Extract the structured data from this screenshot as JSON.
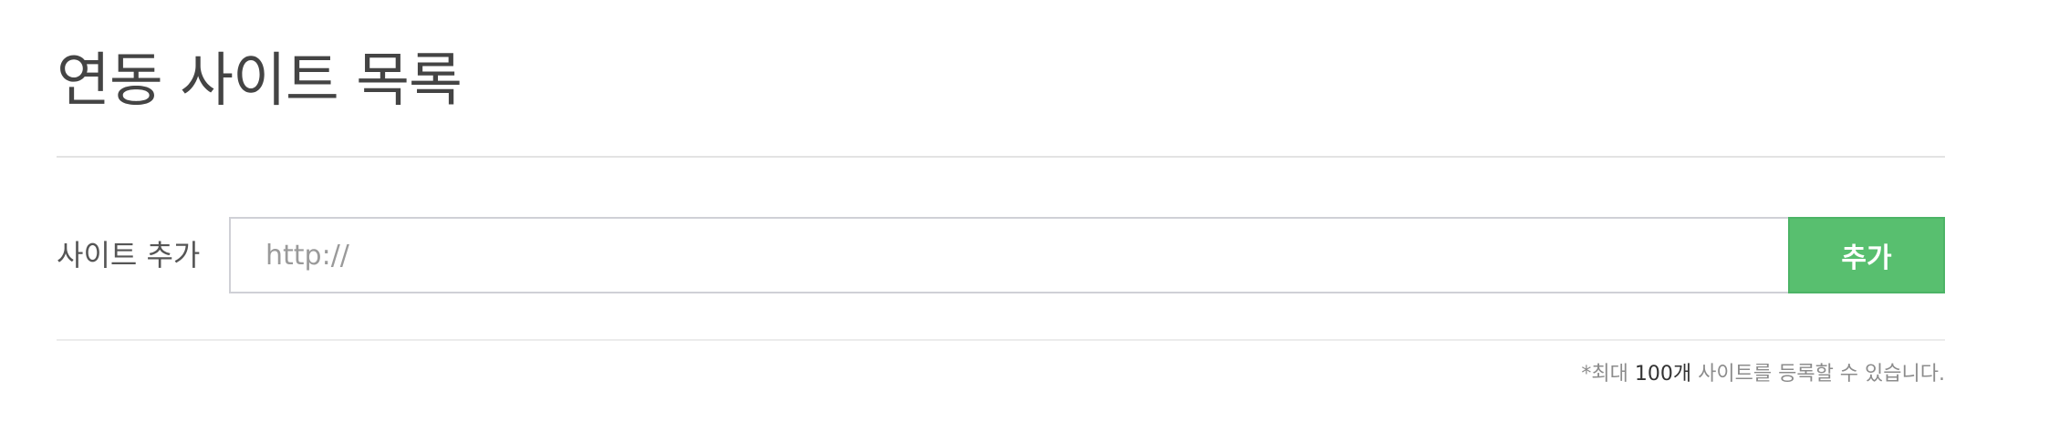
{
  "header": {
    "title": "연동 사이트 목록"
  },
  "add_site": {
    "label": "사이트 추가",
    "input_placeholder": "http://",
    "input_value": "",
    "button_label": "추가",
    "button_color": "#58bf6f"
  },
  "notice": {
    "prefix": "*최대 ",
    "count": "100개",
    "suffix": " 사이트를 등록할 수 있습니다."
  }
}
